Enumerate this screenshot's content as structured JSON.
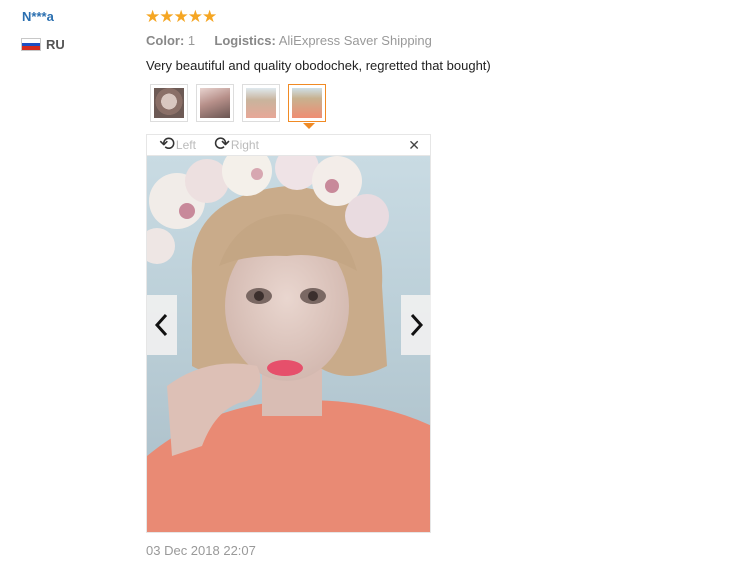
{
  "reviewer": {
    "name": "N***a",
    "country": "RU",
    "flag_colors": [
      "#ffffff",
      "#1c4fc4",
      "#d52b1e"
    ]
  },
  "review": {
    "stars": "★★★★★",
    "rating": 5,
    "color_label": "Color:",
    "color_value": "1",
    "logistics_label": "Logistics:",
    "logistics_value": "AliExpress Saver Shipping",
    "text": "Very beautiful and quality obodochek, regretted that bought)",
    "date": "03 Dec 2018 22:07"
  },
  "photos": {
    "thumbnail_count": 4,
    "active_index": 3
  },
  "viewer": {
    "rotate_left_label": "Left",
    "rotate_right_label": "Right",
    "close_glyph": "✕"
  },
  "colors": {
    "accent": "#f08a24",
    "star": "#f5a623",
    "username": "#2a6fb0"
  }
}
